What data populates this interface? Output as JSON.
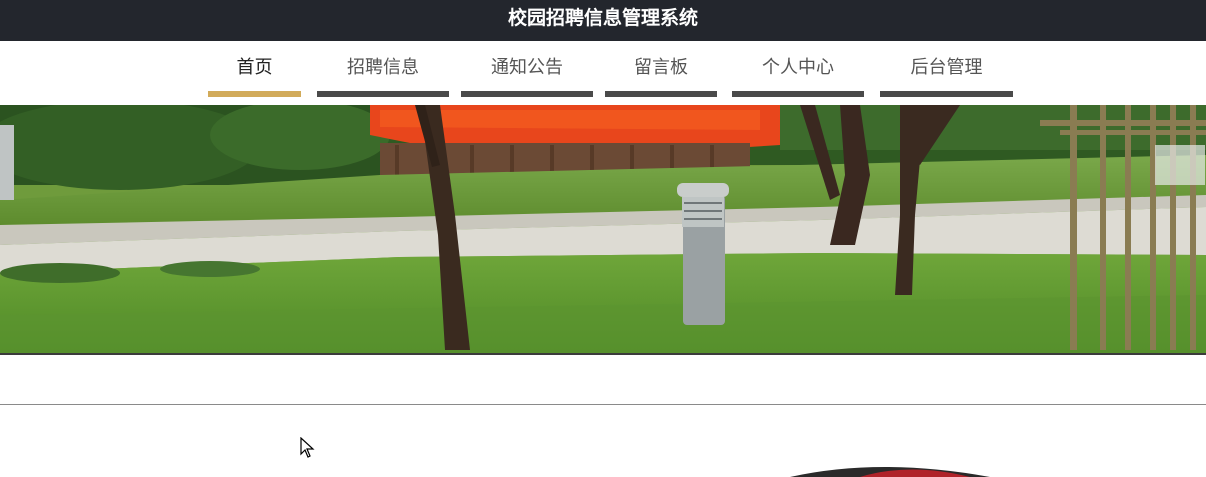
{
  "header": {
    "title": "校园招聘信息管理系统"
  },
  "nav": {
    "items": [
      {
        "label": "首页",
        "active": true
      },
      {
        "label": "招聘信息",
        "active": false
      },
      {
        "label": "通知公告",
        "active": false
      },
      {
        "label": "留言板",
        "active": false
      },
      {
        "label": "个人中心",
        "active": false
      },
      {
        "label": "后台管理",
        "active": false
      }
    ]
  },
  "colors": {
    "topbar": "#23262d",
    "nav_active_underline": "#d2ab5a",
    "nav_underline": "#4a4a4a"
  },
  "icons": {
    "cursor": "mouse-pointer-icon"
  }
}
